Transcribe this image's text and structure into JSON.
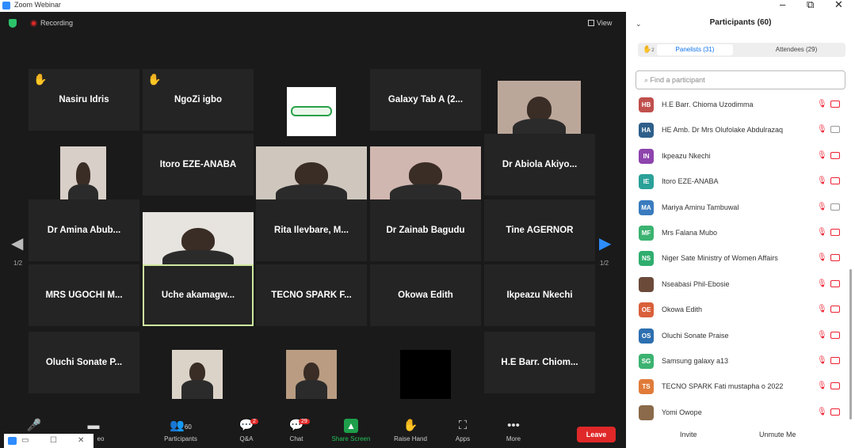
{
  "window": {
    "title": "Zoom Webinar"
  },
  "meeting": {
    "recording_label": "Recording",
    "view_label": "View",
    "page_indicator": "1/2",
    "tiles": [
      {
        "name": "Nasiru Idris",
        "hand": true,
        "video": false
      },
      {
        "name": "NgoZi igbo",
        "hand": true,
        "video": false
      },
      {
        "name": "",
        "hand": false,
        "video": true,
        "kind": "logo"
      },
      {
        "name": "Galaxy Tab A (2...",
        "hand": false,
        "video": false
      },
      {
        "name": "",
        "hand": false,
        "video": true,
        "kind": "person"
      },
      {
        "name": "",
        "hand": false,
        "video": true,
        "kind": "person"
      },
      {
        "name": "Itoro EZE-ANABA",
        "hand": false,
        "video": false
      },
      {
        "name": "",
        "hand": false,
        "video": true,
        "kind": "person"
      },
      {
        "name": "",
        "hand": false,
        "video": true,
        "kind": "person"
      },
      {
        "name": "Dr Abiola Akiyo...",
        "hand": false,
        "video": false
      },
      {
        "name": "Dr Amina Abub...",
        "hand": false,
        "video": false
      },
      {
        "name": "",
        "hand": false,
        "video": true,
        "kind": "person"
      },
      {
        "name": "Rita Ilevbare, M...",
        "hand": false,
        "video": false
      },
      {
        "name": "Dr Zainab Bagudu",
        "hand": false,
        "video": false
      },
      {
        "name": "Tine AGERNOR",
        "hand": false,
        "video": false
      },
      {
        "name": "MRS UGOCHI M...",
        "hand": false,
        "video": false
      },
      {
        "name": "Uche  akamagw...",
        "hand": false,
        "video": false,
        "active": true
      },
      {
        "name": "TECNO SPARK F...",
        "hand": false,
        "video": false
      },
      {
        "name": "Okowa Edith",
        "hand": false,
        "video": false
      },
      {
        "name": "Ikpeazu Nkechi",
        "hand": false,
        "video": false
      },
      {
        "name": "Oluchi Sonate P...",
        "hand": false,
        "video": false
      },
      {
        "name": "",
        "hand": false,
        "video": true,
        "kind": "person"
      },
      {
        "name": "",
        "hand": false,
        "video": true,
        "kind": "person"
      },
      {
        "name": "",
        "hand": false,
        "video": true,
        "kind": "black"
      },
      {
        "name": "H.E Barr. Chiom...",
        "hand": false,
        "video": false
      }
    ]
  },
  "toolbar": {
    "video_label": "eo",
    "participants_label": "Participants",
    "participants_count": "60",
    "qa_label": "Q&A",
    "qa_badge": "2",
    "chat_label": "Chat",
    "chat_badge": "29",
    "share_label": "Share Screen",
    "raise_label": "Raise Hand",
    "apps_label": "Apps",
    "more_label": "More",
    "leave_label": "Leave"
  },
  "panel": {
    "title": "Participants (60)",
    "tab_panelists": "Panelists (31)",
    "tab_attendees": "Attendees (29)",
    "hand_count": "2",
    "search_placeholder": "Find a participant",
    "invite_label": "Invite",
    "unmute_label": "Unmute Me",
    "participants": [
      {
        "initials": "HB",
        "name": "H.E Barr. Chioma Uzodimma",
        "color": "#c0504d",
        "cam_off": true
      },
      {
        "initials": "HA",
        "name": "HE Amb. Dr Mrs Olufolake Abdulrazaq",
        "color": "#2e5f8a",
        "cam_off": false
      },
      {
        "initials": "IN",
        "name": "Ikpeazu Nkechi",
        "color": "#8e44ad",
        "cam_off": true
      },
      {
        "initials": "IE",
        "name": "Itoro EZE-ANABA",
        "color": "#2aa198",
        "cam_off": true
      },
      {
        "initials": "MA",
        "name": "Mariya Aminu Tambuwal",
        "color": "#3a7bbf",
        "cam_off": false
      },
      {
        "initials": "MF",
        "name": "Mrs Falana Mubo",
        "color": "#3cb371",
        "cam_off": true
      },
      {
        "initials": "NS",
        "name": "Niger Sate Ministry of Women Affairs",
        "color": "#2fae6e",
        "cam_off": true
      },
      {
        "initials": "",
        "name": "Nseabasi Phil-Ebosie",
        "color": "#6b4a3a",
        "cam_off": true
      },
      {
        "initials": "OE",
        "name": "Okowa Edith",
        "color": "#d9603b",
        "cam_off": true
      },
      {
        "initials": "OS",
        "name": "Oluchi Sonate Praise",
        "color": "#2e6fb0",
        "cam_off": true
      },
      {
        "initials": "SG",
        "name": "Samsung galaxy a13",
        "color": "#3cb371",
        "cam_off": true
      },
      {
        "initials": "TS",
        "name": "TECNO SPARK Fati mustapha o 2022",
        "color": "#e07b39",
        "cam_off": true
      },
      {
        "initials": "",
        "name": "Yomi Owope",
        "color": "#8a6a4a",
        "cam_off": true
      }
    ]
  }
}
